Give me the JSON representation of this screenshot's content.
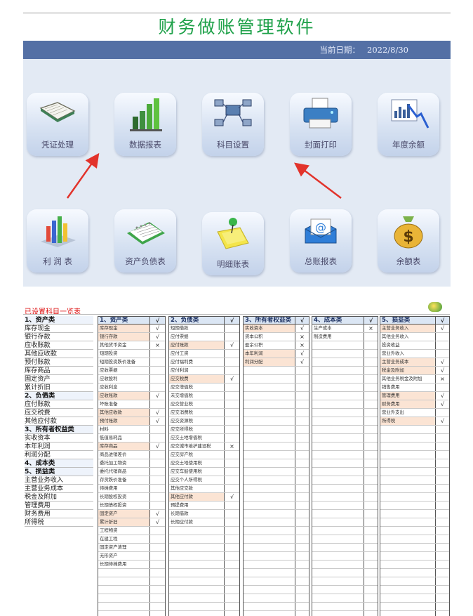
{
  "app": {
    "title": "财务做账管理软件",
    "date_label": "当前日期：",
    "date_value": "2022/8/30"
  },
  "tiles": [
    {
      "label": "凭证处理",
      "icon": "ledger-book-icon"
    },
    {
      "label": "数据报表",
      "icon": "bar-chart-icon"
    },
    {
      "label": "科目设置",
      "icon": "network-computers-icon"
    },
    {
      "label": "封面打印",
      "icon": "printer-icon"
    },
    {
      "label": "年度余额",
      "icon": "trend-chart-icon"
    },
    {
      "label": "利 润 表",
      "icon": "3d-bar-chart-icon"
    },
    {
      "label": "资产负债表",
      "icon": "calendar-icon"
    },
    {
      "label": "明细账表",
      "icon": "sticky-note-pin-icon"
    },
    {
      "label": "总账报表",
      "icon": "email-envelope-icon"
    },
    {
      "label": "余额表",
      "icon": "money-bag-icon"
    }
  ],
  "accounts": {
    "title": "已设置科目一览表",
    "left_list": [
      {
        "text": "1、资产类",
        "cat": true
      },
      {
        "text": "库存现金"
      },
      {
        "text": "银行存款"
      },
      {
        "text": "应收账款"
      },
      {
        "text": "其他应收款"
      },
      {
        "text": "预付账款"
      },
      {
        "text": "库存商品"
      },
      {
        "text": "固定资产"
      },
      {
        "text": "累计折旧"
      },
      {
        "text": "2、负债类",
        "cat": true
      },
      {
        "text": "应付账款"
      },
      {
        "text": "应交税费"
      },
      {
        "text": "其他应付款"
      },
      {
        "text": "3、所有者权益类",
        "cat": true
      },
      {
        "text": "实收资本"
      },
      {
        "text": "本年利润"
      },
      {
        "text": "利润分配"
      },
      {
        "text": "4、成本类",
        "cat": true
      },
      {
        "text": "5、损益类",
        "cat": true
      },
      {
        "text": "主营业务收入"
      },
      {
        "text": "主营业务成本"
      },
      {
        "text": "税金及附加"
      },
      {
        "text": "管理费用"
      },
      {
        "text": "财务费用"
      },
      {
        "text": "所得税"
      }
    ],
    "columns": [
      {
        "header": "1、资产类",
        "mark": "√",
        "rows": [
          {
            "name": "库存现金",
            "mark": "√",
            "hl": true
          },
          {
            "name": "银行存款",
            "mark": "√",
            "hl": true
          },
          {
            "name": "其他货币资金",
            "mark": "×"
          },
          {
            "name": "短期投资",
            "mark": ""
          },
          {
            "name": "短期投资跌价准备",
            "mark": ""
          },
          {
            "name": "应收票据",
            "mark": ""
          },
          {
            "name": "应收股利",
            "mark": ""
          },
          {
            "name": "应收利息",
            "mark": ""
          },
          {
            "name": "应收账款",
            "mark": "√",
            "hl": true
          },
          {
            "name": "坏账准备",
            "mark": ""
          },
          {
            "name": "其他应收款",
            "mark": "√",
            "hl": true
          },
          {
            "name": "预付账款",
            "mark": "√",
            "hl": true
          },
          {
            "name": "材料",
            "mark": ""
          },
          {
            "name": "低值易耗品",
            "mark": ""
          },
          {
            "name": "库存商品",
            "mark": "√",
            "hl": true
          },
          {
            "name": "商品进销差价",
            "mark": ""
          },
          {
            "name": "委托加工物资",
            "mark": ""
          },
          {
            "name": "委托代销商品",
            "mark": ""
          },
          {
            "name": "存货跌价准备",
            "mark": ""
          },
          {
            "name": "待摊费用",
            "mark": ""
          },
          {
            "name": "长期股权投资",
            "mark": ""
          },
          {
            "name": "长期债权投资",
            "mark": ""
          },
          {
            "name": "固定资产",
            "mark": "√",
            "hl": true
          },
          {
            "name": "累计折旧",
            "mark": "√",
            "hl": true
          },
          {
            "name": "工程物资",
            "mark": ""
          },
          {
            "name": "在建工程",
            "mark": ""
          },
          {
            "name": "固定资产清理",
            "mark": ""
          },
          {
            "name": "无形资产",
            "mark": ""
          },
          {
            "name": "长期待摊费用",
            "mark": ""
          },
          {
            "name": "",
            "mark": ""
          },
          {
            "name": "",
            "mark": ""
          },
          {
            "name": "",
            "mark": ""
          },
          {
            "name": "",
            "mark": ""
          },
          {
            "name": "",
            "mark": ""
          },
          {
            "name": "",
            "mark": ""
          }
        ]
      },
      {
        "header": "2、负债类",
        "mark": "√",
        "rows": [
          {
            "name": "短期借款",
            "mark": ""
          },
          {
            "name": "应付票据",
            "mark": ""
          },
          {
            "name": "应付账款",
            "mark": "√",
            "hl": true
          },
          {
            "name": "应付工资",
            "mark": ""
          },
          {
            "name": "应付福利费",
            "mark": ""
          },
          {
            "name": "应付利润",
            "mark": ""
          },
          {
            "name": "应交税费",
            "mark": "√",
            "hl": true
          },
          {
            "name": "应交增值税",
            "mark": ""
          },
          {
            "name": "未交增值税",
            "mark": ""
          },
          {
            "name": "应交营业税",
            "mark": ""
          },
          {
            "name": "应交消费税",
            "mark": ""
          },
          {
            "name": "应交资源税",
            "mark": ""
          },
          {
            "name": "应交所得税",
            "mark": ""
          },
          {
            "name": "应交土地增值税",
            "mark": ""
          },
          {
            "name": "应交城市维护建设税",
            "mark": "×"
          },
          {
            "name": "应交房产税",
            "mark": ""
          },
          {
            "name": "应交土地使用税",
            "mark": ""
          },
          {
            "name": "应交车船使用税",
            "mark": ""
          },
          {
            "name": "应交个人所得税",
            "mark": ""
          },
          {
            "name": "其他应交款",
            "mark": ""
          },
          {
            "name": "其他应付款",
            "mark": "√",
            "hl": true
          },
          {
            "name": "预提费用",
            "mark": ""
          },
          {
            "name": "长期借款",
            "mark": ""
          },
          {
            "name": "长期应付款",
            "mark": ""
          },
          {
            "name": "",
            "mark": ""
          },
          {
            "name": "",
            "mark": ""
          },
          {
            "name": "",
            "mark": ""
          },
          {
            "name": "",
            "mark": ""
          },
          {
            "name": "",
            "mark": ""
          },
          {
            "name": "",
            "mark": ""
          },
          {
            "name": "",
            "mark": ""
          },
          {
            "name": "",
            "mark": ""
          },
          {
            "name": "",
            "mark": ""
          },
          {
            "name": "",
            "mark": ""
          },
          {
            "name": "",
            "mark": ""
          }
        ]
      },
      {
        "header": "3、所有者权益类",
        "mark": "√",
        "rows": [
          {
            "name": "实收资本",
            "mark": "√",
            "hl": true
          },
          {
            "name": "资本公积",
            "mark": "×"
          },
          {
            "name": "盈余公积",
            "mark": "×"
          },
          {
            "name": "本年利润",
            "mark": "√",
            "hl": true
          },
          {
            "name": "利润分配",
            "mark": "√",
            "hl": true
          },
          {
            "name": "",
            "mark": ""
          },
          {
            "name": "",
            "mark": ""
          },
          {
            "name": "",
            "mark": ""
          },
          {
            "name": "",
            "mark": ""
          },
          {
            "name": "",
            "mark": ""
          },
          {
            "name": "",
            "mark": ""
          },
          {
            "name": "",
            "mark": ""
          },
          {
            "name": "",
            "mark": ""
          },
          {
            "name": "",
            "mark": ""
          },
          {
            "name": "",
            "mark": ""
          },
          {
            "name": "",
            "mark": ""
          },
          {
            "name": "",
            "mark": ""
          },
          {
            "name": "",
            "mark": ""
          },
          {
            "name": "",
            "mark": ""
          },
          {
            "name": "",
            "mark": ""
          },
          {
            "name": "",
            "mark": ""
          },
          {
            "name": "",
            "mark": ""
          },
          {
            "name": "",
            "mark": ""
          },
          {
            "name": "",
            "mark": ""
          },
          {
            "name": "",
            "mark": ""
          },
          {
            "name": "",
            "mark": ""
          },
          {
            "name": "",
            "mark": ""
          },
          {
            "name": "",
            "mark": ""
          },
          {
            "name": "",
            "mark": ""
          },
          {
            "name": "",
            "mark": ""
          },
          {
            "name": "",
            "mark": ""
          },
          {
            "name": "",
            "mark": ""
          },
          {
            "name": "",
            "mark": ""
          },
          {
            "name": "",
            "mark": ""
          },
          {
            "name": "",
            "mark": ""
          }
        ]
      },
      {
        "header": "4、成本类",
        "mark": "√",
        "rows": [
          {
            "name": "生产成本",
            "mark": "×"
          },
          {
            "name": "制造费用",
            "mark": ""
          },
          {
            "name": "",
            "mark": ""
          },
          {
            "name": "",
            "mark": ""
          },
          {
            "name": "",
            "mark": ""
          },
          {
            "name": "",
            "mark": ""
          },
          {
            "name": "",
            "mark": ""
          },
          {
            "name": "",
            "mark": ""
          },
          {
            "name": "",
            "mark": ""
          },
          {
            "name": "",
            "mark": ""
          },
          {
            "name": "",
            "mark": ""
          },
          {
            "name": "",
            "mark": ""
          },
          {
            "name": "",
            "mark": ""
          },
          {
            "name": "",
            "mark": ""
          },
          {
            "name": "",
            "mark": ""
          },
          {
            "name": "",
            "mark": ""
          },
          {
            "name": "",
            "mark": ""
          },
          {
            "name": "",
            "mark": ""
          },
          {
            "name": "",
            "mark": ""
          },
          {
            "name": "",
            "mark": ""
          },
          {
            "name": "",
            "mark": ""
          },
          {
            "name": "",
            "mark": ""
          },
          {
            "name": "",
            "mark": ""
          },
          {
            "name": "",
            "mark": ""
          },
          {
            "name": "",
            "mark": ""
          },
          {
            "name": "",
            "mark": ""
          },
          {
            "name": "",
            "mark": ""
          },
          {
            "name": "",
            "mark": ""
          },
          {
            "name": "",
            "mark": ""
          },
          {
            "name": "",
            "mark": ""
          },
          {
            "name": "",
            "mark": ""
          },
          {
            "name": "",
            "mark": ""
          },
          {
            "name": "",
            "mark": ""
          },
          {
            "name": "",
            "mark": ""
          },
          {
            "name": "",
            "mark": ""
          }
        ]
      },
      {
        "header": "5、损益类",
        "mark": "√",
        "rows": [
          {
            "name": "主营业务收入",
            "mark": "√",
            "hl": true
          },
          {
            "name": "其他业务收入",
            "mark": ""
          },
          {
            "name": "投资收益",
            "mark": ""
          },
          {
            "name": "营业外收入",
            "mark": ""
          },
          {
            "name": "主营业务成本",
            "mark": "√",
            "hl": true
          },
          {
            "name": "税金及附加",
            "mark": "√",
            "hl": true
          },
          {
            "name": "其他业务税金及附加",
            "mark": "×"
          },
          {
            "name": "销售费用",
            "mark": ""
          },
          {
            "name": "管理费用",
            "mark": "√",
            "hl": true
          },
          {
            "name": "财务费用",
            "mark": "√",
            "hl": true
          },
          {
            "name": "营业外支出",
            "mark": ""
          },
          {
            "name": "所得税",
            "mark": "√",
            "hl": true
          },
          {
            "name": "",
            "mark": ""
          },
          {
            "name": "",
            "mark": ""
          },
          {
            "name": "",
            "mark": ""
          },
          {
            "name": "",
            "mark": ""
          },
          {
            "name": "",
            "mark": ""
          },
          {
            "name": "",
            "mark": ""
          },
          {
            "name": "",
            "mark": ""
          },
          {
            "name": "",
            "mark": ""
          },
          {
            "name": "",
            "mark": ""
          },
          {
            "name": "",
            "mark": ""
          },
          {
            "name": "",
            "mark": ""
          },
          {
            "name": "",
            "mark": ""
          },
          {
            "name": "",
            "mark": ""
          },
          {
            "name": "",
            "mark": ""
          },
          {
            "name": "",
            "mark": ""
          },
          {
            "name": "",
            "mark": ""
          },
          {
            "name": "",
            "mark": ""
          },
          {
            "name": "",
            "mark": ""
          },
          {
            "name": "",
            "mark": ""
          },
          {
            "name": "",
            "mark": ""
          },
          {
            "name": "",
            "mark": ""
          },
          {
            "name": "",
            "mark": ""
          },
          {
            "name": "",
            "mark": ""
          }
        ]
      }
    ]
  },
  "colors": {
    "title_green": "#1fa14a",
    "header_blue": "#5470a5",
    "dashboard_bg": "#e3eaf4",
    "arrow_red": "#e2332b",
    "highlight_row": "#fbe4d4"
  }
}
